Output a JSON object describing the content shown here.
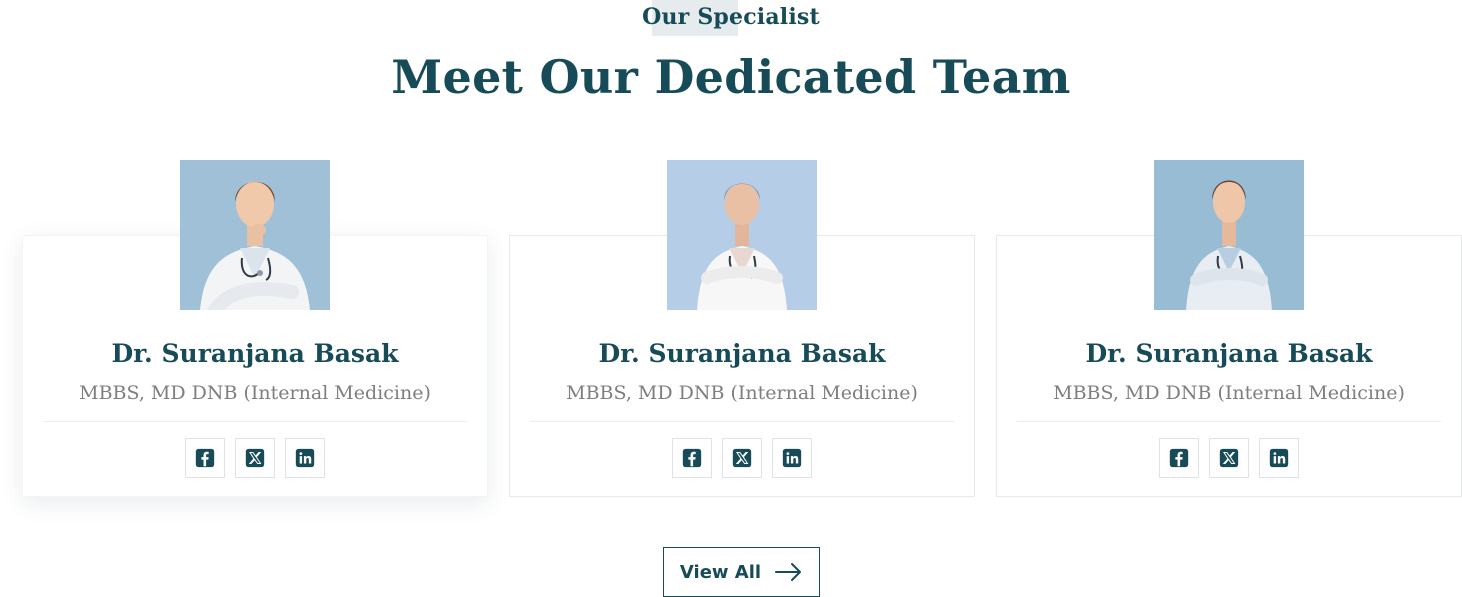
{
  "header": {
    "eyebrow": "Our Specialist",
    "title": "Meet Our Dedicated Team"
  },
  "team": [
    {
      "name": "Dr. Suranjana Basak",
      "degree": "MBBS, MD DNB (Internal Medicine)",
      "photo": "young-female-doctor-hand-on-chin",
      "socials": [
        "facebook-icon",
        "x-icon",
        "linkedin-icon"
      ]
    },
    {
      "name": "Dr. Suranjana Basak",
      "degree": "MBBS, MD DNB (Internal Medicine)",
      "photo": "senior-female-doctor-arms-crossed",
      "socials": [
        "facebook-icon",
        "x-icon",
        "linkedin-icon"
      ]
    },
    {
      "name": "Dr. Suranjana Basak",
      "degree": "MBBS, MD DNB (Internal Medicine)",
      "photo": "young-female-doctor-arms-crossed",
      "socials": [
        "facebook-icon",
        "x-icon",
        "linkedin-icon"
      ]
    }
  ],
  "cta": {
    "label": "View All",
    "icon": "arrow-right-icon"
  },
  "colors": {
    "primary": "#164b57",
    "muted_text": "#7e7e7e",
    "eyebrow_bg": "#e6ecee",
    "photo_bg": "#9fc0d6"
  }
}
